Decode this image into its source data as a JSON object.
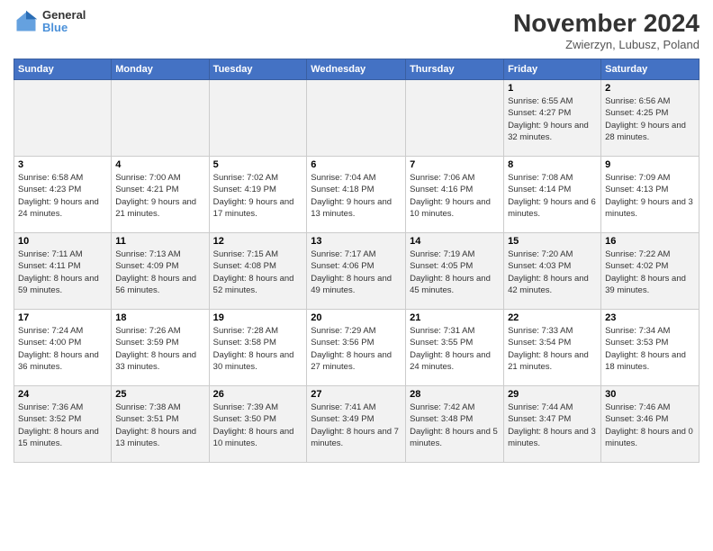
{
  "app": {
    "name": "GeneralBlue",
    "logo_text_line1": "General",
    "logo_text_line2": "Blue"
  },
  "header": {
    "month_year": "November 2024",
    "location": "Zwierzyn, Lubusz, Poland"
  },
  "weekdays": [
    "Sunday",
    "Monday",
    "Tuesday",
    "Wednesday",
    "Thursday",
    "Friday",
    "Saturday"
  ],
  "weeks": [
    {
      "days": [
        {
          "number": "",
          "sunrise": "",
          "sunset": "",
          "daylight": ""
        },
        {
          "number": "",
          "sunrise": "",
          "sunset": "",
          "daylight": ""
        },
        {
          "number": "",
          "sunrise": "",
          "sunset": "",
          "daylight": ""
        },
        {
          "number": "",
          "sunrise": "",
          "sunset": "",
          "daylight": ""
        },
        {
          "number": "",
          "sunrise": "",
          "sunset": "",
          "daylight": ""
        },
        {
          "number": "1",
          "sunrise": "Sunrise: 6:55 AM",
          "sunset": "Sunset: 4:27 PM",
          "daylight": "Daylight: 9 hours and 32 minutes."
        },
        {
          "number": "2",
          "sunrise": "Sunrise: 6:56 AM",
          "sunset": "Sunset: 4:25 PM",
          "daylight": "Daylight: 9 hours and 28 minutes."
        }
      ]
    },
    {
      "days": [
        {
          "number": "3",
          "sunrise": "Sunrise: 6:58 AM",
          "sunset": "Sunset: 4:23 PM",
          "daylight": "Daylight: 9 hours and 24 minutes."
        },
        {
          "number": "4",
          "sunrise": "Sunrise: 7:00 AM",
          "sunset": "Sunset: 4:21 PM",
          "daylight": "Daylight: 9 hours and 21 minutes."
        },
        {
          "number": "5",
          "sunrise": "Sunrise: 7:02 AM",
          "sunset": "Sunset: 4:19 PM",
          "daylight": "Daylight: 9 hours and 17 minutes."
        },
        {
          "number": "6",
          "sunrise": "Sunrise: 7:04 AM",
          "sunset": "Sunset: 4:18 PM",
          "daylight": "Daylight: 9 hours and 13 minutes."
        },
        {
          "number": "7",
          "sunrise": "Sunrise: 7:06 AM",
          "sunset": "Sunset: 4:16 PM",
          "daylight": "Daylight: 9 hours and 10 minutes."
        },
        {
          "number": "8",
          "sunrise": "Sunrise: 7:08 AM",
          "sunset": "Sunset: 4:14 PM",
          "daylight": "Daylight: 9 hours and 6 minutes."
        },
        {
          "number": "9",
          "sunrise": "Sunrise: 7:09 AM",
          "sunset": "Sunset: 4:13 PM",
          "daylight": "Daylight: 9 hours and 3 minutes."
        }
      ]
    },
    {
      "days": [
        {
          "number": "10",
          "sunrise": "Sunrise: 7:11 AM",
          "sunset": "Sunset: 4:11 PM",
          "daylight": "Daylight: 8 hours and 59 minutes."
        },
        {
          "number": "11",
          "sunrise": "Sunrise: 7:13 AM",
          "sunset": "Sunset: 4:09 PM",
          "daylight": "Daylight: 8 hours and 56 minutes."
        },
        {
          "number": "12",
          "sunrise": "Sunrise: 7:15 AM",
          "sunset": "Sunset: 4:08 PM",
          "daylight": "Daylight: 8 hours and 52 minutes."
        },
        {
          "number": "13",
          "sunrise": "Sunrise: 7:17 AM",
          "sunset": "Sunset: 4:06 PM",
          "daylight": "Daylight: 8 hours and 49 minutes."
        },
        {
          "number": "14",
          "sunrise": "Sunrise: 7:19 AM",
          "sunset": "Sunset: 4:05 PM",
          "daylight": "Daylight: 8 hours and 45 minutes."
        },
        {
          "number": "15",
          "sunrise": "Sunrise: 7:20 AM",
          "sunset": "Sunset: 4:03 PM",
          "daylight": "Daylight: 8 hours and 42 minutes."
        },
        {
          "number": "16",
          "sunrise": "Sunrise: 7:22 AM",
          "sunset": "Sunset: 4:02 PM",
          "daylight": "Daylight: 8 hours and 39 minutes."
        }
      ]
    },
    {
      "days": [
        {
          "number": "17",
          "sunrise": "Sunrise: 7:24 AM",
          "sunset": "Sunset: 4:00 PM",
          "daylight": "Daylight: 8 hours and 36 minutes."
        },
        {
          "number": "18",
          "sunrise": "Sunrise: 7:26 AM",
          "sunset": "Sunset: 3:59 PM",
          "daylight": "Daylight: 8 hours and 33 minutes."
        },
        {
          "number": "19",
          "sunrise": "Sunrise: 7:28 AM",
          "sunset": "Sunset: 3:58 PM",
          "daylight": "Daylight: 8 hours and 30 minutes."
        },
        {
          "number": "20",
          "sunrise": "Sunrise: 7:29 AM",
          "sunset": "Sunset: 3:56 PM",
          "daylight": "Daylight: 8 hours and 27 minutes."
        },
        {
          "number": "21",
          "sunrise": "Sunrise: 7:31 AM",
          "sunset": "Sunset: 3:55 PM",
          "daylight": "Daylight: 8 hours and 24 minutes."
        },
        {
          "number": "22",
          "sunrise": "Sunrise: 7:33 AM",
          "sunset": "Sunset: 3:54 PM",
          "daylight": "Daylight: 8 hours and 21 minutes."
        },
        {
          "number": "23",
          "sunrise": "Sunrise: 7:34 AM",
          "sunset": "Sunset: 3:53 PM",
          "daylight": "Daylight: 8 hours and 18 minutes."
        }
      ]
    },
    {
      "days": [
        {
          "number": "24",
          "sunrise": "Sunrise: 7:36 AM",
          "sunset": "Sunset: 3:52 PM",
          "daylight": "Daylight: 8 hours and 15 minutes."
        },
        {
          "number": "25",
          "sunrise": "Sunrise: 7:38 AM",
          "sunset": "Sunset: 3:51 PM",
          "daylight": "Daylight: 8 hours and 13 minutes."
        },
        {
          "number": "26",
          "sunrise": "Sunrise: 7:39 AM",
          "sunset": "Sunset: 3:50 PM",
          "daylight": "Daylight: 8 hours and 10 minutes."
        },
        {
          "number": "27",
          "sunrise": "Sunrise: 7:41 AM",
          "sunset": "Sunset: 3:49 PM",
          "daylight": "Daylight: 8 hours and 7 minutes."
        },
        {
          "number": "28",
          "sunrise": "Sunrise: 7:42 AM",
          "sunset": "Sunset: 3:48 PM",
          "daylight": "Daylight: 8 hours and 5 minutes."
        },
        {
          "number": "29",
          "sunrise": "Sunrise: 7:44 AM",
          "sunset": "Sunset: 3:47 PM",
          "daylight": "Daylight: 8 hours and 3 minutes."
        },
        {
          "number": "30",
          "sunrise": "Sunrise: 7:46 AM",
          "sunset": "Sunset: 3:46 PM",
          "daylight": "Daylight: 8 hours and 0 minutes."
        }
      ]
    }
  ]
}
